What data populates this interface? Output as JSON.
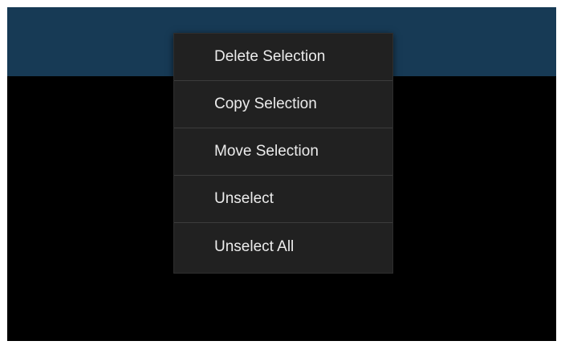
{
  "colors": {
    "header": "#173a55",
    "screen": "#000000",
    "menu_background": "#212121",
    "menu_divider": "#3c3c3c",
    "menu_text": "#ececec"
  },
  "context_menu": {
    "items": [
      {
        "label": "Delete Selection"
      },
      {
        "label": "Copy Selection"
      },
      {
        "label": "Move Selection"
      },
      {
        "label": "Unselect"
      },
      {
        "label": "Unselect All"
      }
    ]
  }
}
